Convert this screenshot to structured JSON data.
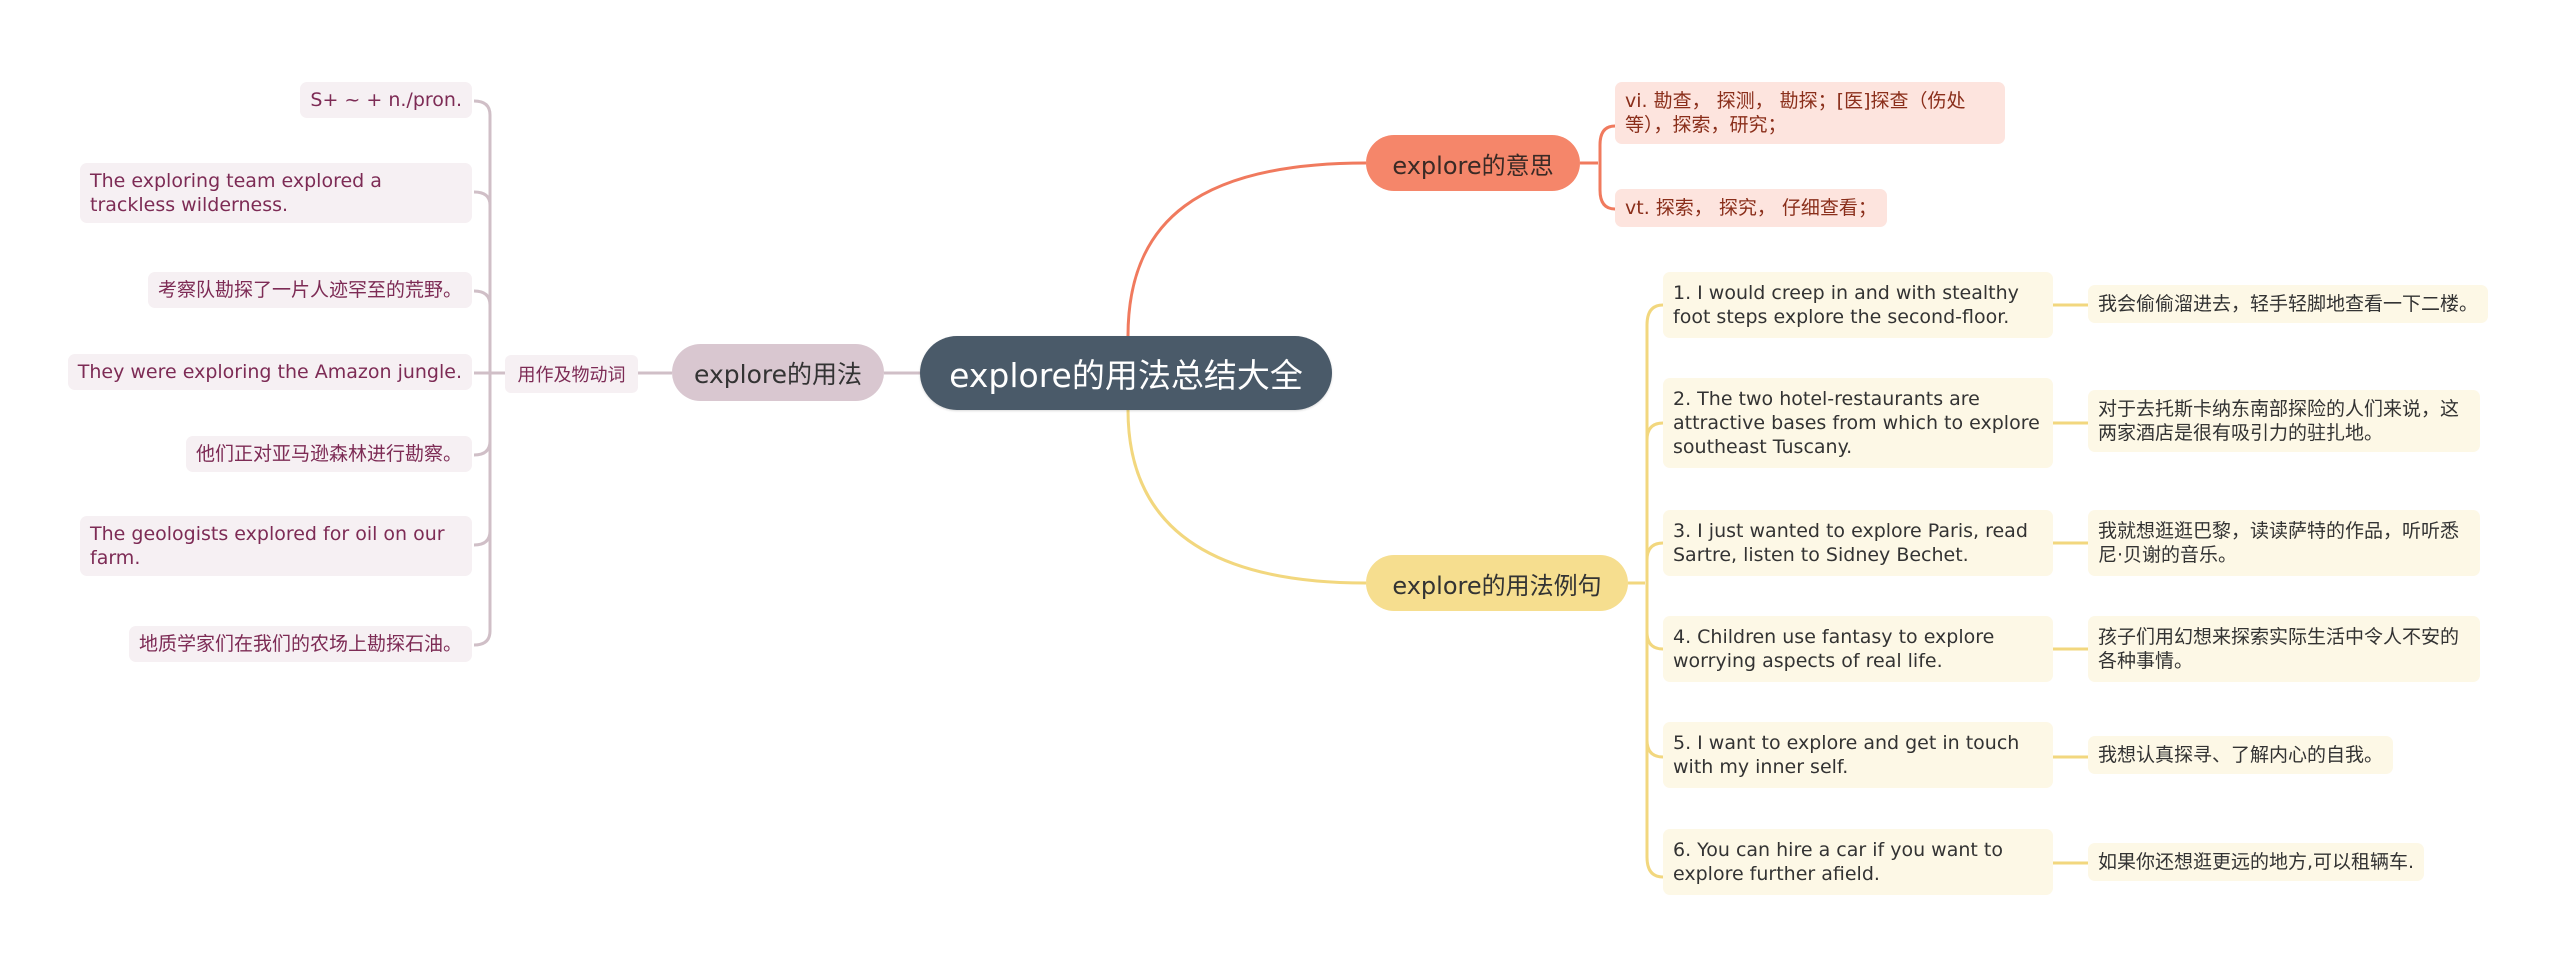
{
  "root": {
    "label": "explore的用法总结大全"
  },
  "colors": {
    "root_bg": "#4a5a69",
    "usage_branch": "#d9c7d0",
    "meaning_branch": "#f5866a",
    "example_branch": "#f6de8f",
    "usage_text": "#7d2b55",
    "meaning_text": "#8a2e1a"
  },
  "usage_branch": {
    "label": "explore的用法",
    "sub_label": "用作及物动词",
    "items": [
      "S+ ~ + n./pron.",
      "The exploring team explored a trackless wilderness.",
      "考察队勘探了一片人迹罕至的荒野。",
      "They were exploring the Amazon jungle.",
      "他们正对亚马逊森林进行勘察。",
      "The geologists explored for oil on our farm.",
      "地质学家们在我们的农场上勘探石油。"
    ]
  },
  "meaning_branch": {
    "label": "explore的意思",
    "items": [
      "vi. 勘查， 探测， 勘探；[医]探查（伤处等），探索，研究；",
      "vt. 探索， 探究， 仔细查看；"
    ]
  },
  "example_branch": {
    "label": "explore的用法例句",
    "items": [
      {
        "en": "1. I would creep in and with stealthy foot steps explore the second-floor.",
        "zh": "我会偷偷溜进去，轻手轻脚地查看一下二楼。"
      },
      {
        "en": "2. The two hotel-restaurants are attractive bases from which to explore southeast Tuscany.",
        "zh": "对于去托斯卡纳东南部探险的人们来说，这两家酒店是很有吸引力的驻扎地。"
      },
      {
        "en": "3. I just wanted to explore Paris, read Sartre, listen to Sidney Bechet.",
        "zh": "我就想逛逛巴黎，读读萨特的作品，听听悉尼·贝谢的音乐。"
      },
      {
        "en": "4. Children use fantasy to explore worrying aspects of real life.",
        "zh": "孩子们用幻想来探索实际生活中令人不安的各种事情。"
      },
      {
        "en": "5. I want to explore and get in touch with my inner self.",
        "zh": "我想认真探寻、了解内心的自我。"
      },
      {
        "en": "6. You can hire a car if you want to explore further afield.",
        "zh": "如果你还想逛更远的地方,可以租辆车."
      }
    ]
  }
}
